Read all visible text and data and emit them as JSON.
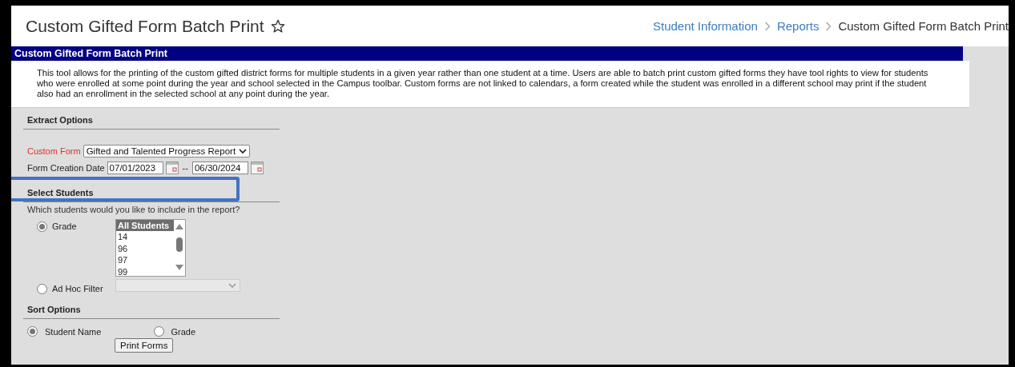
{
  "header": {
    "title": "Custom Gifted Form Batch Print",
    "favorite": false,
    "breadcrumbs": [
      {
        "label": "Student Information",
        "kind": "link"
      },
      {
        "label": "Reports",
        "kind": "link"
      },
      {
        "label": "Custom Gifted Form Batch Print",
        "kind": "current"
      }
    ]
  },
  "banner": {
    "title": "Custom Gifted Form Batch Print"
  },
  "description": "This tool allows for the printing of the custom gifted district forms for multiple students in a given year rather than one student at a time. Users are able to batch print custom gifted forms they have tool rights to view for students who were enrolled at some point during the year and school selected in the Campus toolbar. Custom forms are not linked to calendars, a form created while the student was enrolled in a different school may print if the student also had an enrollment in the selected school at any point during the year.",
  "extract_options": {
    "heading": "Extract Options",
    "custom_form": {
      "label": "Custom Form",
      "required": true,
      "value": "Gifted and Talented Progress Report"
    },
    "date": {
      "label": "Form Creation Date",
      "start": "07/01/2023",
      "separator": "--",
      "end": "06/30/2024"
    }
  },
  "select_students": {
    "heading": "Select Students",
    "highlighted": true,
    "prompt": "Which students would you like to include in the report?",
    "options": [
      {
        "label": "Grade",
        "selected": true,
        "kind": "list",
        "items": [
          {
            "label": "All Students",
            "selected": true
          },
          {
            "label": "14",
            "selected": false
          },
          {
            "label": "96",
            "selected": false
          },
          {
            "label": "97",
            "selected": false
          },
          {
            "label": "99",
            "selected": false
          }
        ]
      },
      {
        "label": "Ad Hoc Filter",
        "selected": false,
        "kind": "dropdown",
        "disabled": true
      }
    ]
  },
  "sort_options": {
    "heading": "Sort Options",
    "options": [
      {
        "label": "Student Name",
        "selected": true
      },
      {
        "label": "Grade",
        "selected": false
      }
    ]
  },
  "print_button": "Print Forms"
}
